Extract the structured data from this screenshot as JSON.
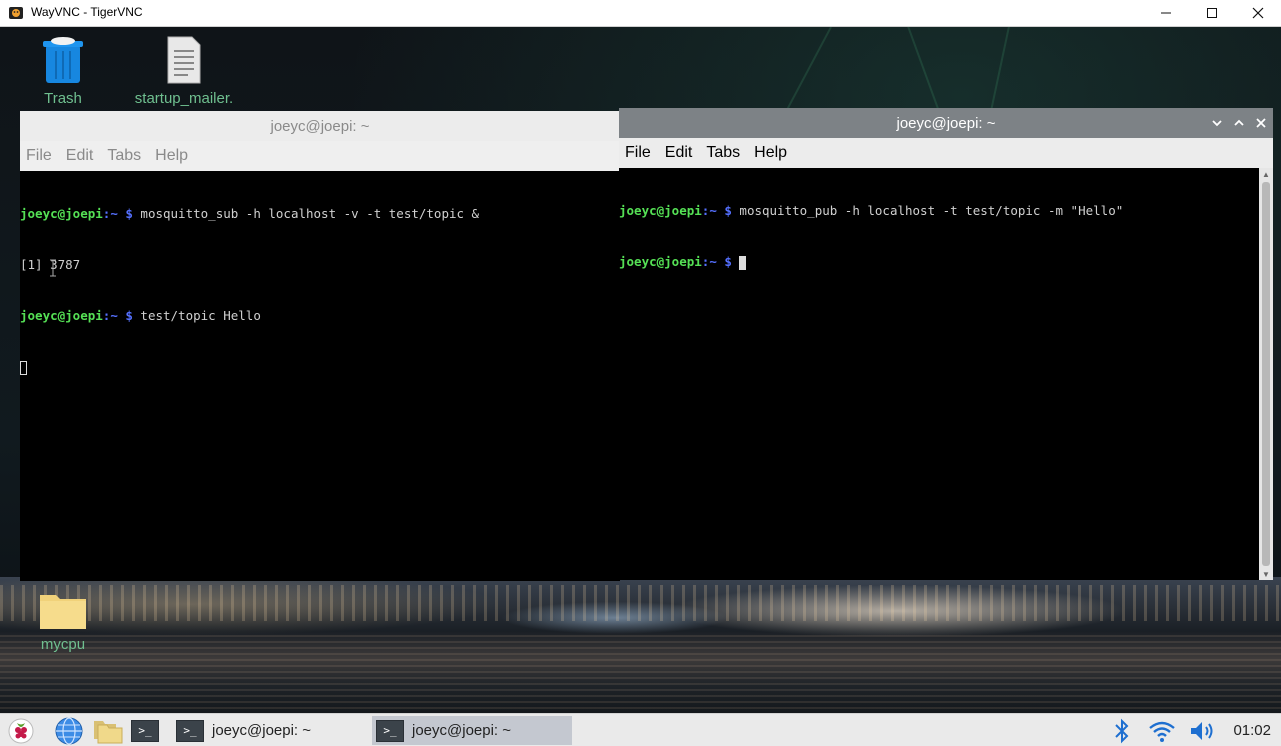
{
  "vnc_window": {
    "title": "WayVNC - TigerVNC",
    "minimize_icon": "minimize-icon",
    "maximize_icon": "maximize-icon",
    "close_icon": "close-icon"
  },
  "desktop": {
    "icons": [
      {
        "label": "Trash",
        "icon": "trash-icon"
      },
      {
        "label": "startup_mailer.",
        "icon": "text-file-icon"
      },
      {
        "label": "mycpu",
        "icon": "folder-icon"
      }
    ]
  },
  "terminals": {
    "left": {
      "title": "joeyc@joepi: ~",
      "menu": [
        "File",
        "Edit",
        "Tabs",
        "Help"
      ],
      "lines": [
        {
          "user": "joeyc@joepi",
          "path": ":~ $",
          "cmd": " mosquitto_sub -h localhost -v -t test/topic &"
        },
        {
          "plain": "[1] 3787"
        },
        {
          "user": "joeyc@joepi",
          "path": ":~ $",
          "cmd": " test/topic Hello"
        }
      ]
    },
    "right": {
      "title": "joeyc@joepi: ~",
      "menu": [
        "File",
        "Edit",
        "Tabs",
        "Help"
      ],
      "lines": [
        {
          "user": "joeyc@joepi",
          "path": ":~ $",
          "cmd": " mosquitto_pub -h localhost -t test/topic -m \"Hello\""
        },
        {
          "user": "joeyc@joepi",
          "path": ":~ $",
          "cmd": " "
        }
      ]
    }
  },
  "taskbar": {
    "tasks": [
      {
        "label": "joeyc@joepi: ~",
        "active": false
      },
      {
        "label": "joeyc@joepi: ~",
        "active": true
      }
    ],
    "clock": "01:02",
    "colors": {
      "bluetooth": "#1e6fd0",
      "wifi": "#1e6fd0",
      "volume": "#1e6fd0",
      "raspberry": "#c51a4a"
    }
  }
}
